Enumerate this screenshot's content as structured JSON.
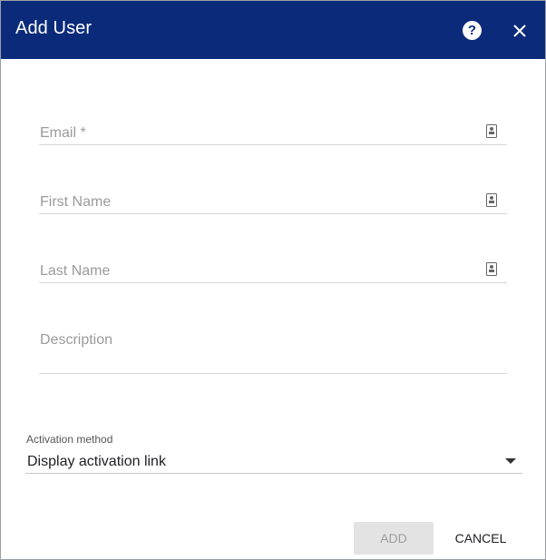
{
  "dialog": {
    "title": "Add User",
    "help_icon": "question-mark-circle-icon",
    "help_glyph": "?",
    "close_icon": "close-x-icon",
    "header_color": "#0b2a7a"
  },
  "form": {
    "email": {
      "placeholder": "Email *",
      "icon": "contact-card-icon"
    },
    "first_name": {
      "placeholder": "First Name",
      "icon": "contact-card-icon"
    },
    "last_name": {
      "placeholder": "Last Name",
      "icon": "contact-card-icon"
    },
    "description": {
      "placeholder": "Description"
    },
    "activation": {
      "label": "Activation method",
      "selected": "Display activation link",
      "icon": "dropdown-arrow-icon"
    }
  },
  "actions": {
    "add_label": "ADD",
    "add_enabled": false,
    "cancel_label": "CANCEL"
  }
}
